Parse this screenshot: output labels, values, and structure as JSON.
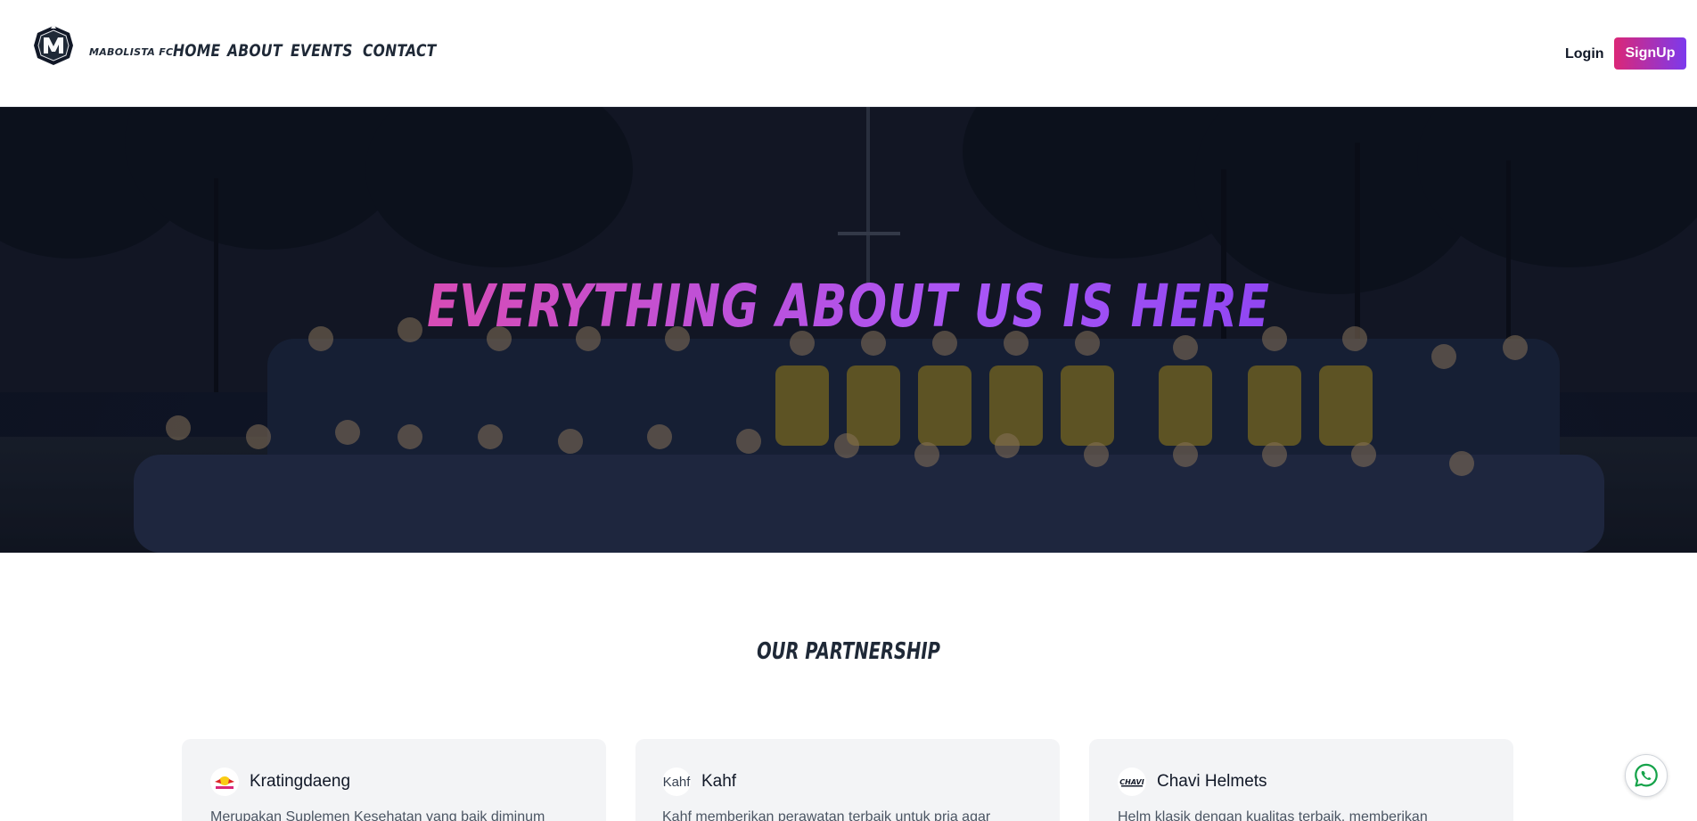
{
  "nav": {
    "brand": "MABOLISTA FC",
    "links": [
      "HOME",
      "ABOUT",
      "EVENTS",
      "CONTACT"
    ],
    "login": "Login",
    "signup": "SignUp"
  },
  "hero": {
    "title": "EVERYTHING ABOUT US IS HERE"
  },
  "partnership": {
    "title": "OUR PARTNERSHIP",
    "cards": [
      {
        "name": "Kratingdaeng",
        "logo_text": "KRATINGDAENG",
        "desc": "Merupakan Suplemen Kesehatan yang baik diminum"
      },
      {
        "name": "Kahf",
        "logo_text": "Kahf",
        "desc": "Kahf memberikan perawatan terbaik untuk pria agar"
      },
      {
        "name": "Chavi Helmets",
        "logo_text": "CHAVI",
        "desc": "Helm klasik dengan kualitas terbaik, memberikan"
      }
    ]
  },
  "colors": {
    "accent_start": "#db2777",
    "accent_end": "#7c3aed",
    "whatsapp": "#16a34a"
  },
  "icons": {
    "whatsapp": "whatsapp-icon",
    "logo": "club-logo-icon"
  }
}
